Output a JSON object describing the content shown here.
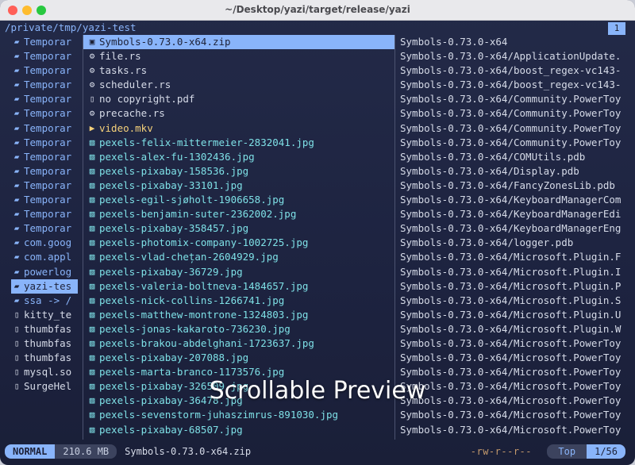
{
  "window": {
    "title": "~/Desktop/yazi/target/release/yazi"
  },
  "header": {
    "path": "/private/tmp/yazi-test",
    "tab_number": "1"
  },
  "parent_list": [
    {
      "name": "Temporar",
      "kind": "folder",
      "icon": "folder-icon"
    },
    {
      "name": "Temporar",
      "kind": "folder",
      "icon": "folder-icon"
    },
    {
      "name": "Temporar",
      "kind": "folder",
      "icon": "folder-icon"
    },
    {
      "name": "Temporar",
      "kind": "folder",
      "icon": "folder-icon"
    },
    {
      "name": "Temporar",
      "kind": "folder",
      "icon": "folder-icon"
    },
    {
      "name": "Temporar",
      "kind": "folder",
      "icon": "folder-icon"
    },
    {
      "name": "Temporar",
      "kind": "folder",
      "icon": "folder-icon"
    },
    {
      "name": "Temporar",
      "kind": "folder",
      "icon": "folder-icon"
    },
    {
      "name": "Temporar",
      "kind": "folder",
      "icon": "folder-icon"
    },
    {
      "name": "Temporar",
      "kind": "folder",
      "icon": "folder-icon"
    },
    {
      "name": "Temporar",
      "kind": "folder",
      "icon": "folder-icon"
    },
    {
      "name": "Temporar",
      "kind": "folder",
      "icon": "folder-icon"
    },
    {
      "name": "Temporar",
      "kind": "folder",
      "icon": "folder-icon"
    },
    {
      "name": "Temporar",
      "kind": "folder",
      "icon": "folder-icon"
    },
    {
      "name": "com.goog",
      "kind": "folder",
      "icon": "folder-icon"
    },
    {
      "name": "com.appl",
      "kind": "folder",
      "icon": "folder-icon"
    },
    {
      "name": "powerlog",
      "kind": "folder",
      "icon": "folder-icon"
    },
    {
      "name": "yazi-tes",
      "kind": "folder",
      "icon": "folder-icon",
      "selected": true
    },
    {
      "name": "ssa -> /",
      "kind": "folder",
      "icon": "folder-symlink-icon"
    },
    {
      "name": "kitty_te",
      "kind": "file",
      "icon": "file-icon"
    },
    {
      "name": "thumbfas",
      "kind": "file",
      "icon": "file-icon"
    },
    {
      "name": "thumbfas",
      "kind": "file",
      "icon": "file-icon"
    },
    {
      "name": "thumbfas",
      "kind": "file",
      "icon": "file-icon"
    },
    {
      "name": "mysql.so",
      "kind": "file",
      "icon": "file-icon"
    },
    {
      "name": "SurgeHel",
      "kind": "file",
      "icon": "file-icon"
    }
  ],
  "current_list": [
    {
      "name": "Symbols-0.73.0-x64.zip",
      "kind": "file",
      "icon": "archive-icon",
      "selected": true
    },
    {
      "name": "file.rs",
      "kind": "file",
      "icon": "rust-icon"
    },
    {
      "name": "tasks.rs",
      "kind": "file",
      "icon": "rust-icon"
    },
    {
      "name": "scheduler.rs",
      "kind": "file",
      "icon": "rust-icon"
    },
    {
      "name": "no copyright.pdf",
      "kind": "file",
      "icon": "pdf-icon"
    },
    {
      "name": "precache.rs",
      "kind": "file",
      "icon": "rust-icon"
    },
    {
      "name": "video.mkv",
      "kind": "video",
      "icon": "video-icon"
    },
    {
      "name": "pexels-felix-mittermeier-2832041.jpg",
      "kind": "img",
      "icon": "image-icon"
    },
    {
      "name": "pexels-alex-fu-1302436.jpg",
      "kind": "img",
      "icon": "image-icon"
    },
    {
      "name": "pexels-pixabay-158536.jpg",
      "kind": "img",
      "icon": "image-icon"
    },
    {
      "name": "pexels-pixabay-33101.jpg",
      "kind": "img",
      "icon": "image-icon"
    },
    {
      "name": "pexels-egil-sjøholt-1906658.jpg",
      "kind": "img",
      "icon": "image-icon"
    },
    {
      "name": "pexels-benjamin-suter-2362002.jpg",
      "kind": "img",
      "icon": "image-icon"
    },
    {
      "name": "pexels-pixabay-358457.jpg",
      "kind": "img",
      "icon": "image-icon"
    },
    {
      "name": "pexels-photomix-company-1002725.jpg",
      "kind": "img",
      "icon": "image-icon"
    },
    {
      "name": "pexels-vlad-chețan-2604929.jpg",
      "kind": "img",
      "icon": "image-icon"
    },
    {
      "name": "pexels-pixabay-36729.jpg",
      "kind": "img",
      "icon": "image-icon"
    },
    {
      "name": "pexels-valeria-boltneva-1484657.jpg",
      "kind": "img",
      "icon": "image-icon"
    },
    {
      "name": "pexels-nick-collins-1266741.jpg",
      "kind": "img",
      "icon": "image-icon"
    },
    {
      "name": "pexels-matthew-montrone-1324803.jpg",
      "kind": "img",
      "icon": "image-icon"
    },
    {
      "name": "pexels-jonas-kakaroto-736230.jpg",
      "kind": "img",
      "icon": "image-icon"
    },
    {
      "name": "pexels-brakou-abdelghani-1723637.jpg",
      "kind": "img",
      "icon": "image-icon"
    },
    {
      "name": "pexels-pixabay-207088.jpg",
      "kind": "img",
      "icon": "image-icon"
    },
    {
      "name": "pexels-marta-branco-1173576.jpg",
      "kind": "img",
      "icon": "image-icon"
    },
    {
      "name": "pexels-pixabay-326509.jpg",
      "kind": "img",
      "icon": "image-icon"
    },
    {
      "name": "pexels-pixabay-36478.jpg",
      "kind": "img",
      "icon": "image-icon"
    },
    {
      "name": "pexels-sevenstorm-juhaszimrus-891030.jpg",
      "kind": "img",
      "icon": "image-icon"
    },
    {
      "name": "pexels-pixabay-68507.jpg",
      "kind": "img",
      "icon": "image-icon"
    }
  ],
  "preview_list": [
    "Symbols-0.73.0-x64",
    "Symbols-0.73.0-x64/ApplicationUpdate.",
    "Symbols-0.73.0-x64/boost_regex-vc143-",
    "Symbols-0.73.0-x64/boost_regex-vc143-",
    "Symbols-0.73.0-x64/Community.PowerToy",
    "Symbols-0.73.0-x64/Community.PowerToy",
    "Symbols-0.73.0-x64/Community.PowerToy",
    "Symbols-0.73.0-x64/Community.PowerToy",
    "Symbols-0.73.0-x64/COMUtils.pdb",
    "Symbols-0.73.0-x64/Display.pdb",
    "Symbols-0.73.0-x64/FancyZonesLib.pdb",
    "Symbols-0.73.0-x64/KeyboardManagerCom",
    "Symbols-0.73.0-x64/KeyboardManagerEdi",
    "Symbols-0.73.0-x64/KeyboardManagerEng",
    "Symbols-0.73.0-x64/logger.pdb",
    "Symbols-0.73.0-x64/Microsoft.Plugin.F",
    "Symbols-0.73.0-x64/Microsoft.Plugin.I",
    "Symbols-0.73.0-x64/Microsoft.Plugin.P",
    "Symbols-0.73.0-x64/Microsoft.Plugin.S",
    "Symbols-0.73.0-x64/Microsoft.Plugin.U",
    "Symbols-0.73.0-x64/Microsoft.Plugin.W",
    "Symbols-0.73.0-x64/Microsoft.PowerToy",
    "Symbols-0.73.0-x64/Microsoft.PowerToy",
    "Symbols-0.73.0-x64/Microsoft.PowerToy",
    "Symbols-0.73.0-x64/Microsoft.PowerToy",
    "Symbols-0.73.0-x64/Microsoft.PowerToy",
    "Symbols-0.73.0-x64/Microsoft.PowerToy",
    "Symbols-0.73.0-x64/Microsoft.PowerToy"
  ],
  "status": {
    "mode": "NORMAL",
    "size": "210.6 MB",
    "filename": "Symbols-0.73.0-x64.zip",
    "permissions": "-rw-r--r--",
    "position_label": "Top",
    "position_count": "1/56"
  },
  "overlay_caption": "Scrollable Preview",
  "colors": {
    "accent": "#89b4fa",
    "folder": "#89b4fa",
    "image": "#7ee0e6",
    "video": "#f5d17a"
  }
}
